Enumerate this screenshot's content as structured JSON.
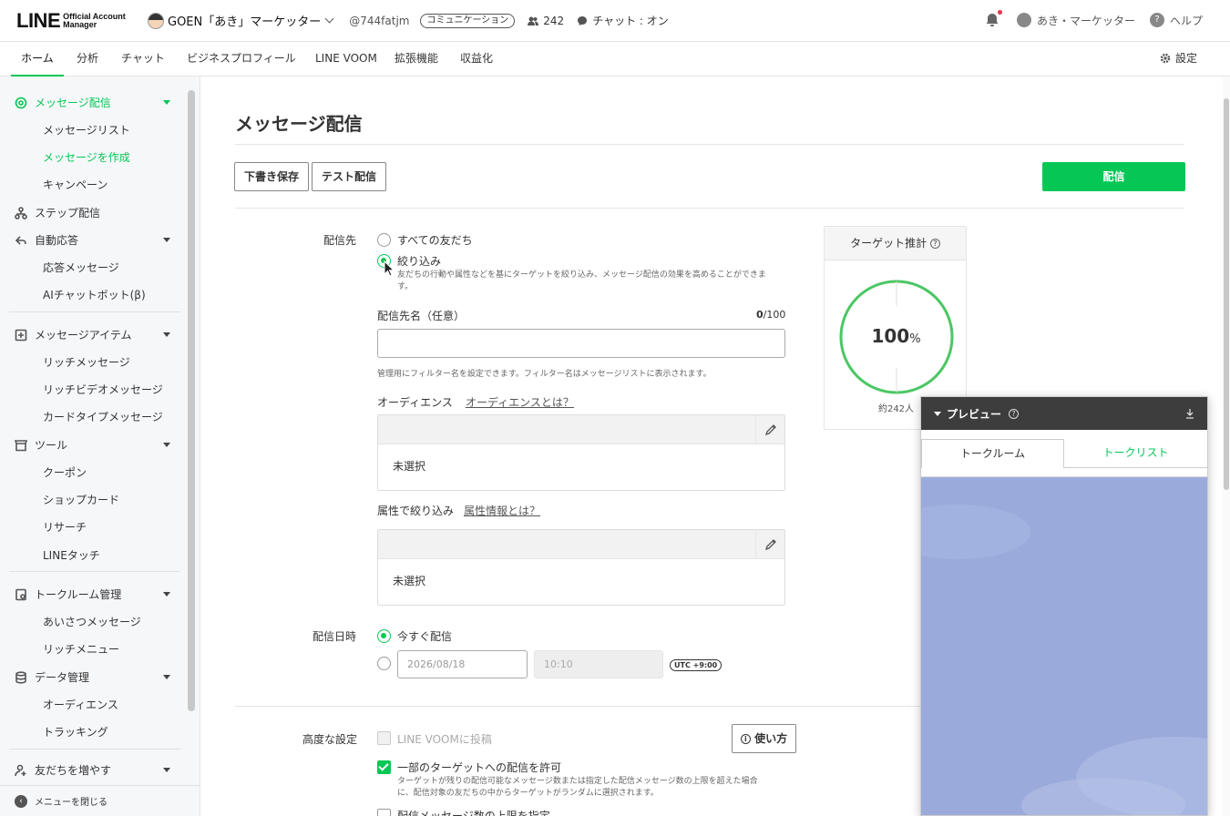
{
  "header": {
    "logo_main": "LINE",
    "logo_sub_1": "Official Account",
    "logo_sub_2": "Manager",
    "account_name": "GOEN「あき」マーケッター",
    "account_id": "@744fatjm",
    "account_badge": "コミュニケーション",
    "friend_count": "242",
    "chat_status": "チャット : オン",
    "user_name": "あき・マーケッター",
    "help": "ヘルプ"
  },
  "nav": {
    "tabs": [
      "ホーム",
      "分析",
      "チャット",
      "ビジネスプロフィール",
      "LINE VOOM",
      "拡張機能",
      "収益化"
    ],
    "active": "ホーム",
    "settings": "設定"
  },
  "sidebar": {
    "message_delivery": "メッセージ配信",
    "message_list": "メッセージリスト",
    "create_message": "メッセージを作成",
    "campaign": "キャンペーン",
    "step_delivery": "ステップ配信",
    "auto_response": "自動応答",
    "response_message": "応答メッセージ",
    "ai_chatbot": "AIチャットボット(β)",
    "message_items": "メッセージアイテム",
    "rich_message": "リッチメッセージ",
    "rich_video_message": "リッチビデオメッセージ",
    "card_type_message": "カードタイプメッセージ",
    "tools": "ツール",
    "coupon": "クーポン",
    "shop_card": "ショップカード",
    "research": "リサーチ",
    "line_touch": "LINEタッチ",
    "talkroom_mgmt": "トークルーム管理",
    "greeting_message": "あいさつメッセージ",
    "rich_menu": "リッチメニュー",
    "data_mgmt": "データ管理",
    "audience": "オーディエンス",
    "tracking": "トラッキング",
    "add_friends": "友だちを増やす",
    "close_menu": "メニューを閉じる"
  },
  "main": {
    "title": "メッセージ配信",
    "save_draft": "下書き保存",
    "test_send": "テスト配信",
    "send": "配信",
    "dest_label": "配信先",
    "all_friends": "すべての友だち",
    "narrow": "絞り込み",
    "narrow_desc_1": "友だちの行動や属性などを基にターゲットを絞り込み、メッセージ配信の効果を高めることができま",
    "narrow_desc_2": "す。",
    "dest_name_label": "配信先名（任意）",
    "dest_name_count": "0",
    "dest_name_max": "/100",
    "dest_name_value": "",
    "filter_note": "管理用にフィルター名を設定できます。フィルター名はメッセージリストに表示されます。",
    "audience_label": "オーディエンス",
    "audience_link": "オーディエンスとは？",
    "audience_value": "未選択",
    "attr_label": "属性で絞り込み",
    "attr_link": "属性情報とは？",
    "attr_value": "未選択",
    "datetime_label": "配信日時",
    "send_now": "今すぐ配信",
    "date_placeholder": "2026/08/18",
    "time_placeholder": "10:10",
    "utc": "UTC +9:00",
    "advanced_label": "高度な設定",
    "voom_post": "LINE VOOMに投稿",
    "how_to": "使い方",
    "allow_partial": "一部のターゲットへの配信を許可",
    "allow_partial_desc_1": "ターゲットが残りの配信可能なメッセージ数または指定した配信メッセージ数の上限を超えた場合",
    "allow_partial_desc_2": "に、配信対象の友だちの中からターゲットがランダムに選択されます。",
    "limit_messages": "配信メッセージ数の上限を指定"
  },
  "target": {
    "title": "ターゲット推計",
    "percent": "100",
    "percent_sign": "%",
    "percent_value": 100,
    "count": "約242人"
  },
  "preview": {
    "title": "プレビュー",
    "tab_talkroom": "トークルーム",
    "tab_talklist": "トークリスト"
  },
  "colors": {
    "accent": "#06c755",
    "preview_bg": "#9aabdb",
    "preview_header": "#3d3d3d"
  }
}
